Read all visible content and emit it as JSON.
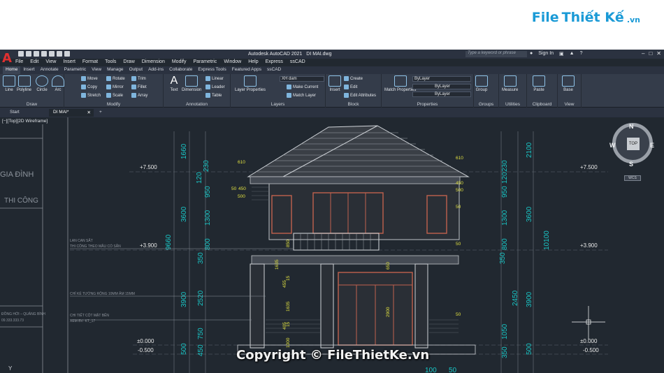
{
  "brand": {
    "file": "File",
    "thiet": "Thiết Kế",
    "vn": ".vn"
  },
  "title": {
    "app": "Autodesk AutoCAD 2021",
    "doc": "DI MAI.dwg"
  },
  "search": {
    "placeholder": "Type a keyword or phrase"
  },
  "signin": "Sign In",
  "menu": [
    "File",
    "Edit",
    "View",
    "Insert",
    "Format",
    "Tools",
    "Draw",
    "Dimension",
    "Modify",
    "Parametric",
    "Window",
    "Help",
    "Express",
    "ssCAD"
  ],
  "ribbon_tabs": [
    "Home",
    "Insert",
    "Annotate",
    "Parametric",
    "View",
    "Manage",
    "Output",
    "Add-ins",
    "Collaborate",
    "Express Tools",
    "Featured Apps",
    "ssCAD"
  ],
  "panels": {
    "draw": {
      "label": "Draw",
      "tools": [
        "Line",
        "Polyline",
        "Circle",
        "Arc"
      ]
    },
    "modify": {
      "label": "Modify",
      "tools": [
        "Move",
        "Rotate",
        "Trim",
        "Copy",
        "Mirror",
        "Fillet",
        "Stretch",
        "Scale",
        "Array"
      ]
    },
    "annotation": {
      "label": "Annotation",
      "tools": [
        "Text",
        "Dimension",
        "Linear",
        "Leader",
        "Table"
      ]
    },
    "layers": {
      "label": "Layers",
      "tools": [
        "Layer Properties",
        "Make Current",
        "Match Layer"
      ],
      "current": "XH dam"
    },
    "block": {
      "label": "Block",
      "tools": [
        "Insert",
        "Create",
        "Edit",
        "Edit Attributes"
      ]
    },
    "properties": {
      "label": "Properties",
      "tools": [
        "Match Properties"
      ],
      "color": "ByLayer",
      "linetype": "ByLayer",
      "lineweight": "ByLayer"
    },
    "groups": {
      "label": "Groups",
      "tools": [
        "Group"
      ]
    },
    "utilities": {
      "label": "Utilities",
      "tools": [
        "Measure"
      ]
    },
    "clipboard": {
      "label": "Clipboard",
      "tools": [
        "Paste"
      ]
    },
    "view": {
      "label": "View",
      "tools": [
        "Base"
      ]
    }
  },
  "doc_tabs": [
    "Start",
    "DI MAI*"
  ],
  "viewport_label": "[−][Top][2D Wireframe]",
  "viewcube": {
    "n": "N",
    "s": "S",
    "e": "E",
    "w": "W",
    "top": "TOP",
    "wcs": "WCS"
  },
  "drawing": {
    "left_panel_text": [
      "GIA ĐÌNH",
      "THI CÔNG"
    ],
    "levels": [
      "+7.500",
      "+3.900",
      "±0.000",
      "-0.500"
    ],
    "dims_left": [
      "1660",
      "3600",
      "9660",
      "3900",
      "500",
      "230",
      "120",
      "950",
      "1300",
      "800",
      "350",
      "2520",
      "750",
      "450"
    ],
    "dims_right": [
      "2100",
      "3600",
      "10100",
      "3900",
      "500",
      "230",
      "120",
      "950",
      "1300",
      "800",
      "350",
      "2450",
      "1050",
      "350"
    ],
    "small_dims": [
      "610",
      "610",
      "50",
      "450",
      "500",
      "450",
      "500",
      "50",
      "50",
      "850",
      "1635",
      "455",
      "15",
      "1635",
      "405",
      "1000",
      "15",
      "650",
      "2900",
      "50"
    ],
    "notes": [
      "LAN CAN SẮT",
      "THI CÔNG THEO MẪU CÓ SẴN",
      "CHỈ KẺ TƯỜNG RỘNG 10MM ÂM 15MM",
      "CHI TIẾT CỘT MẶT BÊN",
      "XEM BV: KT_17"
    ],
    "bottom_dims": [
      "100",
      "50"
    ],
    "side_notes": [
      "ĐỒNG HỚI – QUẢNG BÌNH",
      "09.333.333.73"
    ]
  },
  "watermark": "Copyright © FileThietKe.vn",
  "colors": {
    "app_bg": "#212830",
    "ribbon_bg": "#343c4a",
    "cyan": "#19c7c7",
    "roof": "#cfd3d8",
    "wall": "#c9c9c9",
    "frame": "#c0624d"
  }
}
